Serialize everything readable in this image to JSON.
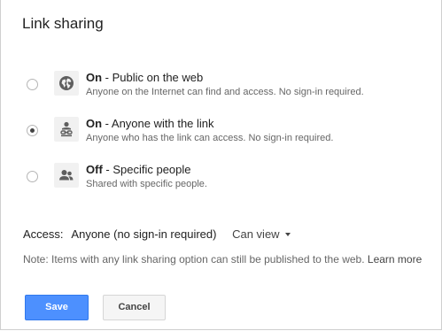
{
  "dialog": {
    "title": "Link sharing"
  },
  "options": [
    {
      "state": "On",
      "title_rest": " - Public on the web",
      "description": "Anyone on the Internet can find and access. No sign-in required.",
      "icon": "globe-icon",
      "selected": false
    },
    {
      "state": "On",
      "title_rest": " - Anyone with the link",
      "description": "Anyone who has the link can access. No sign-in required.",
      "icon": "person-link-icon",
      "selected": true
    },
    {
      "state": "Off",
      "title_rest": " - Specific people",
      "description": "Shared with specific people.",
      "icon": "people-icon",
      "selected": false
    }
  ],
  "access": {
    "label": "Access:",
    "value": "Anyone (no sign-in required)",
    "permission": "Can view"
  },
  "note": {
    "text": "Note: Items with any link sharing option can still be published to the web. ",
    "link": "Learn more"
  },
  "buttons": {
    "save": "Save",
    "cancel": "Cancel"
  },
  "colors": {
    "primary_button": "#4d90fe",
    "icon_background": "#f1f1f1"
  }
}
